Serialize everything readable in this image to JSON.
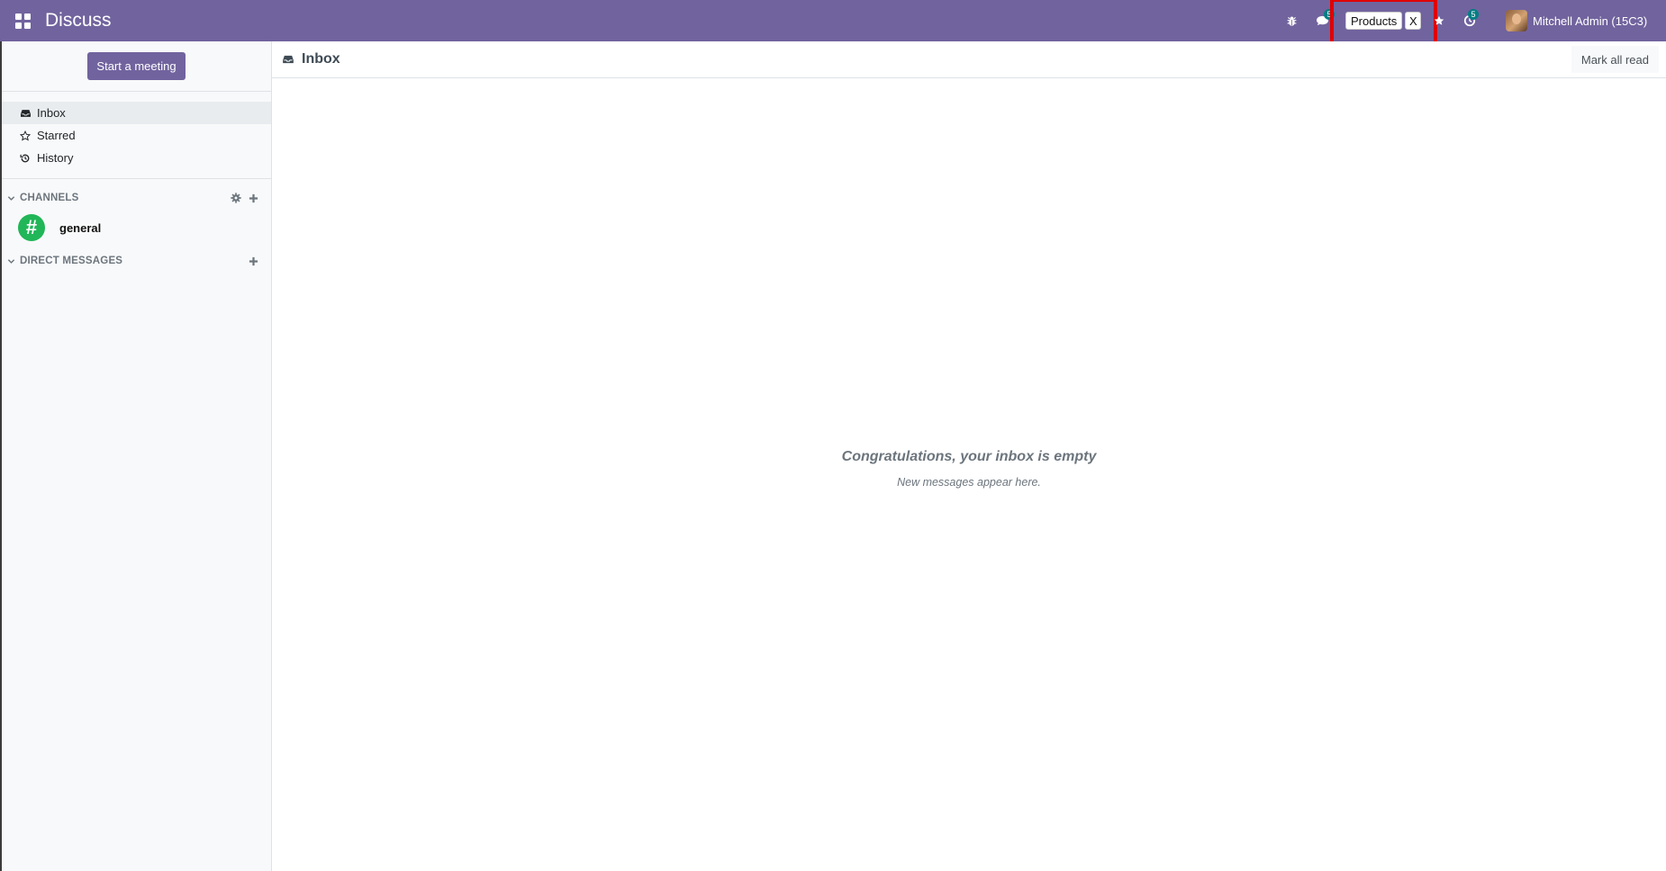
{
  "navbar": {
    "app_title": "Discuss",
    "chat_badge": "5",
    "activity_badge": "5",
    "user_name": "Mitchell Admin (15C3)",
    "color": "#71639e",
    "icons": [
      "apps-icon",
      "bug-icon",
      "chat-icon",
      "star-icon",
      "clock-icon"
    ]
  },
  "chip": {
    "label": "Products",
    "close": "X",
    "highlight_color": "#e00000"
  },
  "sidebar": {
    "start_meeting": "Start a meeting",
    "mailboxes": [
      {
        "label": "Inbox",
        "icon": "inbox-icon",
        "active": true
      },
      {
        "label": "Starred",
        "icon": "star-outline-icon"
      },
      {
        "label": "History",
        "icon": "history-icon"
      }
    ],
    "channels_header": "CHANNELS",
    "channels": [
      {
        "name": "general",
        "avatar": "#",
        "color": "#21b658"
      }
    ],
    "dm_header": "DIRECT MESSAGES"
  },
  "main": {
    "title": "Inbox",
    "mark_all_read": "Mark all read",
    "empty_title": "Congratulations, your inbox is empty",
    "empty_subtitle": "New messages appear here."
  }
}
